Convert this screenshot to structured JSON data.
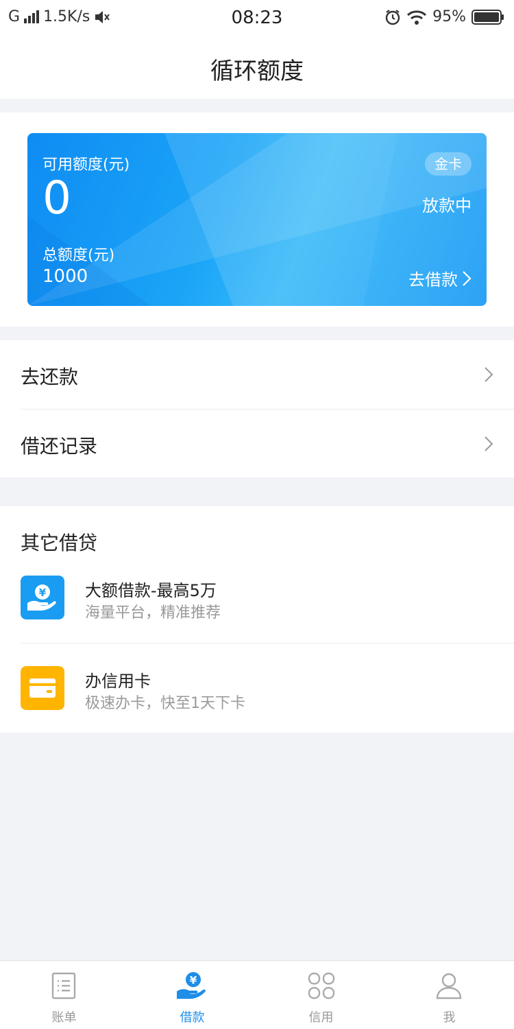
{
  "status_bar": {
    "carrier": "G",
    "net_speed": "1.5K/s",
    "time": "08:23",
    "battery": "95%"
  },
  "nav": {
    "title": "循环额度"
  },
  "card": {
    "available_label": "可用额度(元)",
    "available_amount": "0",
    "total_label": "总额度(元)",
    "total_amount": "1000",
    "badge": "金卡",
    "status": "放款中",
    "borrow_label": "去借款"
  },
  "menu": {
    "repay": "去还款",
    "records": "借还记录"
  },
  "other": {
    "title": "其它借贷",
    "items": [
      {
        "title": "大额借款-最高5万",
        "subtitle": "海量平台，精准推荐",
        "icon": "yuan-hand-icon",
        "color": "#1a9cf2"
      },
      {
        "title": "办信用卡",
        "subtitle": "极速办卡，快至1天下卡",
        "icon": "credit-card-icon",
        "color": "#ffb400"
      }
    ]
  },
  "tabbar": {
    "items": [
      {
        "label": "账单",
        "icon": "bill-icon"
      },
      {
        "label": "借款",
        "icon": "yuan-hand-icon"
      },
      {
        "label": "信用",
        "icon": "grid-icon"
      },
      {
        "label": "我",
        "icon": "user-icon"
      }
    ],
    "active_color": "#1e8ee8"
  }
}
